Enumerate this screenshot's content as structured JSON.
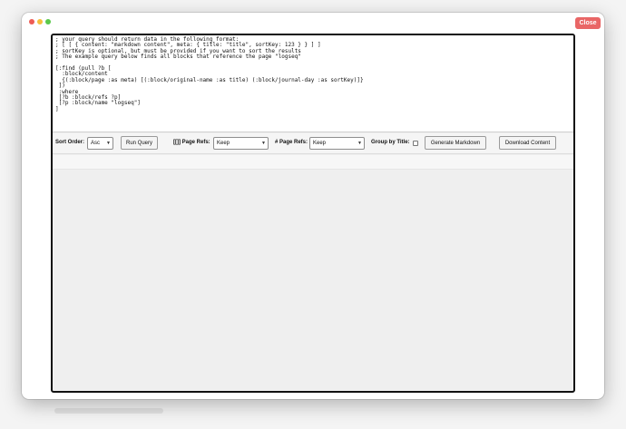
{
  "window": {
    "close_label": "Close"
  },
  "editor": {
    "lines": [
      "; your query should return data in the following format:",
      "; [ [ { content: \"markdown content\", meta: { title: \"title\", sortKey: 123 } } ] ]",
      "; sortKey is optional, but must be provided if you want to sort the results",
      "; The example query below finds all blocks that reference the page \"logseq\"",
      "",
      "[:find (pull ?b [",
      "  :block/content",
      "  {(:block/page :as meta) [(:block/original-name :as title) (:block/journal-day :as sortKey)]}",
      " ])",
      " :where",
      " [?b :block/refs ?p]",
      " [?p :block/name \"logseq\"]",
      "]"
    ]
  },
  "controls": {
    "sort_order_label": "Sort Order:",
    "sort_order_value": "Asc",
    "run_query_label": "Run Query",
    "bracket_refs_label": "[[]] Page Refs:",
    "bracket_refs_value": "Keep",
    "hash_refs_label": "# Page Refs:",
    "hash_refs_value": "Keep",
    "group_by_title_label": "Group by Title:",
    "generate_label": "Generate Markdown",
    "download_label": "Download Content"
  }
}
